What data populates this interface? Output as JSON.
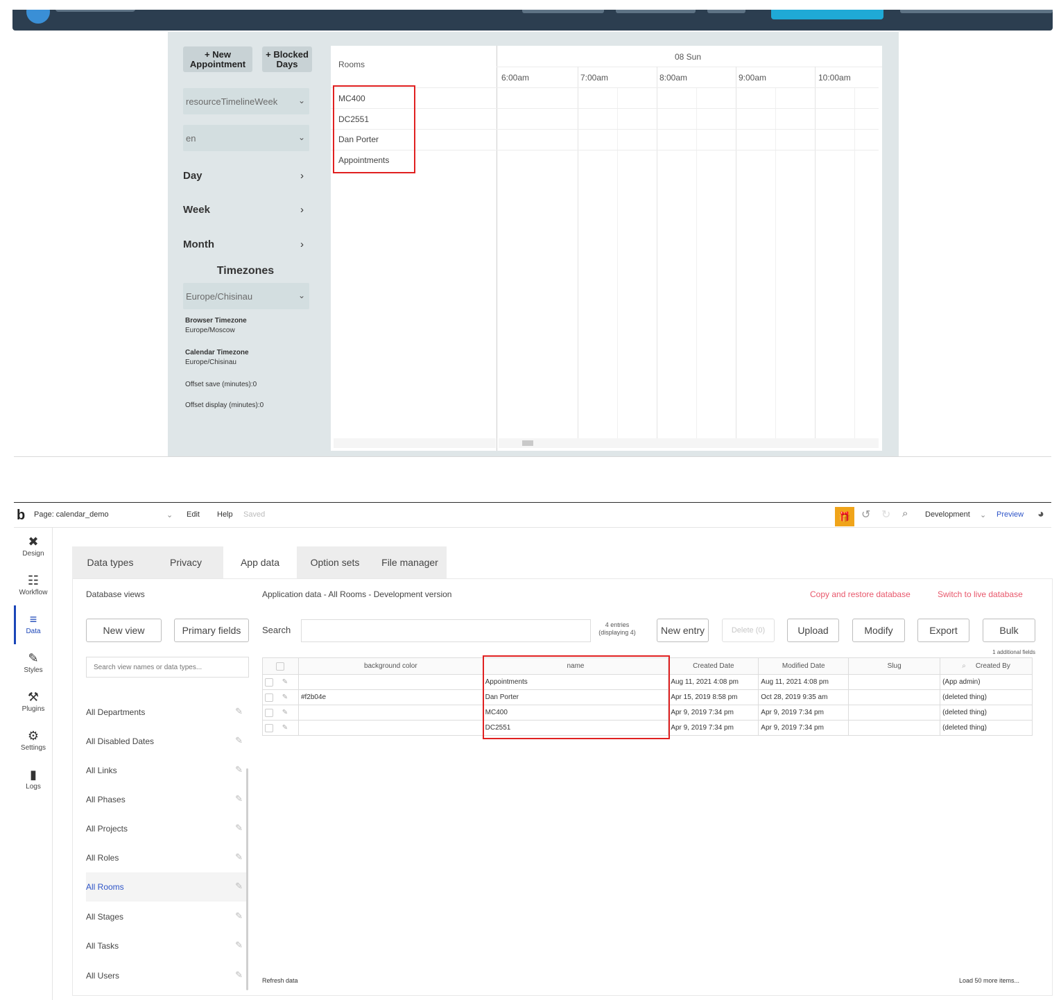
{
  "calendar_app": {
    "buttons": {
      "new_appointment": "+ New\nAppointment",
      "blocked_days": "+ Blocked\nDays"
    },
    "view_select": "resourceTimelineWeek",
    "lang_select": "en",
    "nav": {
      "day": "Day",
      "week": "Week",
      "month": "Month"
    },
    "timezones_heading": "Timezones",
    "tz_select": "Europe/Chisinau",
    "browser_tz_label": "Browser Timezone",
    "browser_tz_value": "Europe/Moscow",
    "calendar_tz_label": "Calendar Timezone",
    "calendar_tz_value": "Europe/Chisinau",
    "offset_save": "Offset save (minutes):0",
    "offset_display": "Offset display (minutes):0",
    "timeline": {
      "resource_header": "Rooms",
      "date_header": "08 Sun",
      "times": [
        "6:00am",
        "7:00am",
        "8:00am",
        "9:00am",
        "10:00am"
      ],
      "resources": [
        "MC400",
        "DC2551",
        "Dan Porter",
        "Appointments"
      ]
    }
  },
  "editor": {
    "page_label": "Page: calendar_demo",
    "menu": {
      "edit": "Edit",
      "help": "Help",
      "saved": "Saved"
    },
    "env": "Development",
    "preview": "Preview",
    "nav": [
      "Design",
      "Workflow",
      "Data",
      "Styles",
      "Plugins",
      "Settings",
      "Logs"
    ],
    "tabs": [
      "Data types",
      "Privacy",
      "App data",
      "Option sets",
      "File manager"
    ],
    "db_views_title": "Database views",
    "new_view": "New view",
    "primary_fields": "Primary fields",
    "search_views_placeholder": "Search view names or data types...",
    "views": [
      "All Departments",
      "All Disabled Dates",
      "All Links",
      "All Phases",
      "All Projects",
      "All Roles",
      "All Rooms",
      "All Stages",
      "All Tasks",
      "All Users"
    ],
    "app_data_title": "Application data - All Rooms - Development version",
    "copy_restore": "Copy and restore database",
    "switch_live": "Switch to live database",
    "search_label": "Search",
    "entries_count": "4 entries",
    "entries_displaying": "(displaying 4)",
    "actions": {
      "new_entry": "New entry",
      "delete": "Delete (0)",
      "upload": "Upload",
      "modify": "Modify",
      "export": "Export",
      "bulk": "Bulk"
    },
    "additional_fields": "1 additional fields",
    "columns": [
      "background color",
      "name",
      "Created Date",
      "Modified Date",
      "Slug",
      "Created By"
    ],
    "rows": [
      {
        "bg": "",
        "name": "Appointments",
        "created": "Aug 11, 2021 4:08 pm",
        "modified": "Aug 11, 2021 4:08 pm",
        "slug": "",
        "by": "(App admin)"
      },
      {
        "bg": "#f2b04e",
        "name": "Dan Porter",
        "created": "Apr 15, 2019 8:58 pm",
        "modified": "Oct 28, 2019 9:35 am",
        "slug": "",
        "by": "(deleted thing)"
      },
      {
        "bg": "",
        "name": "MC400",
        "created": "Apr 9, 2019 7:34 pm",
        "modified": "Apr 9, 2019 7:34 pm",
        "slug": "",
        "by": "(deleted thing)"
      },
      {
        "bg": "",
        "name": "DC2551",
        "created": "Apr 9, 2019 7:34 pm",
        "modified": "Apr 9, 2019 7:34 pm",
        "slug": "",
        "by": "(deleted thing)"
      }
    ],
    "refresh_data": "Refresh data",
    "load_more": "Load 50 more items..."
  },
  "colors": {
    "highlight": "#e02020",
    "panel": "#dfe6e8",
    "accent_blue": "#1a45b8",
    "link_red": "#e8576b",
    "gift": "#f0a41a"
  }
}
